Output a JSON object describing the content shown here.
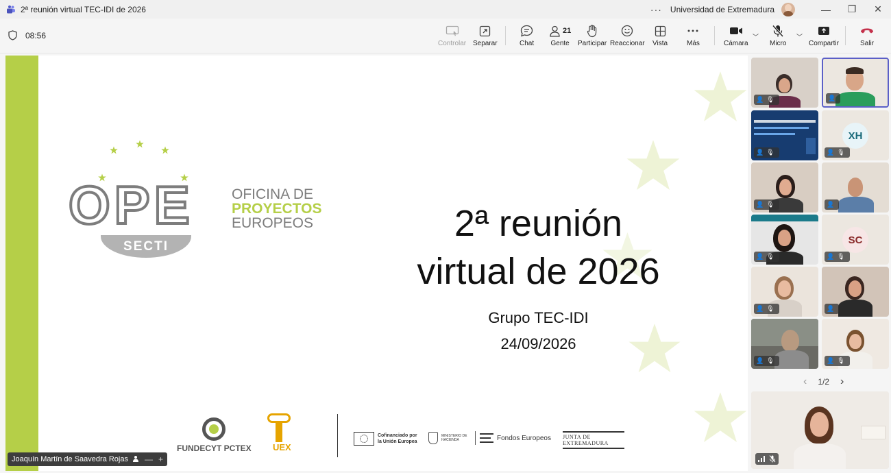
{
  "window": {
    "title": "2ª reunión virtual TEC-IDI de 2026",
    "more": "···",
    "organization": "Universidad de Extremadura",
    "minimize": "—",
    "maximize": "❐",
    "close": "✕"
  },
  "toolbar": {
    "timer": "08:56",
    "controlar": "Controlar",
    "separar": "Separar",
    "chat": "Chat",
    "people_count": "21",
    "gente": "Gente",
    "participar": "Participar",
    "reaccionar": "Reaccionar",
    "vista": "Vista",
    "mas": "Más",
    "camara": "Cámara",
    "micro": "Micro",
    "compartir": "Compartir",
    "salir": "Salir"
  },
  "slide": {
    "logo_ope": "OPE",
    "logo_secti": "SECTI",
    "logo_line1": "OFICINA DE",
    "logo_line2": "PROYECTOS",
    "logo_line3": "EUROPEOS",
    "title_line1": "2ª reunión",
    "title_line2": "virtual de 2026",
    "group": "Grupo TEC-IDI",
    "date": "24/09/2026",
    "footer": {
      "fundecyt": "FUNDECYT PCTEX",
      "uex": "UEX",
      "eu": "Cofinanciado por la Unión Europea",
      "ministerio": "MINISTERIO DE HACIENDA",
      "fondos": "Fondos Europeos",
      "junta": "JUNTA DE EXTREMADURA"
    }
  },
  "presenter": {
    "name": "Joaquín Martín de Saavedra Rojas",
    "minus": "—",
    "plus": "+"
  },
  "gallery": {
    "initials_1": "XH",
    "initials_2": "SC",
    "page": "1/2",
    "prev": "‹",
    "next": "›"
  },
  "colors": {
    "slide_green": "#b5cf48",
    "leave_red": "#c4314b",
    "active_border": "#5b5fc7"
  }
}
